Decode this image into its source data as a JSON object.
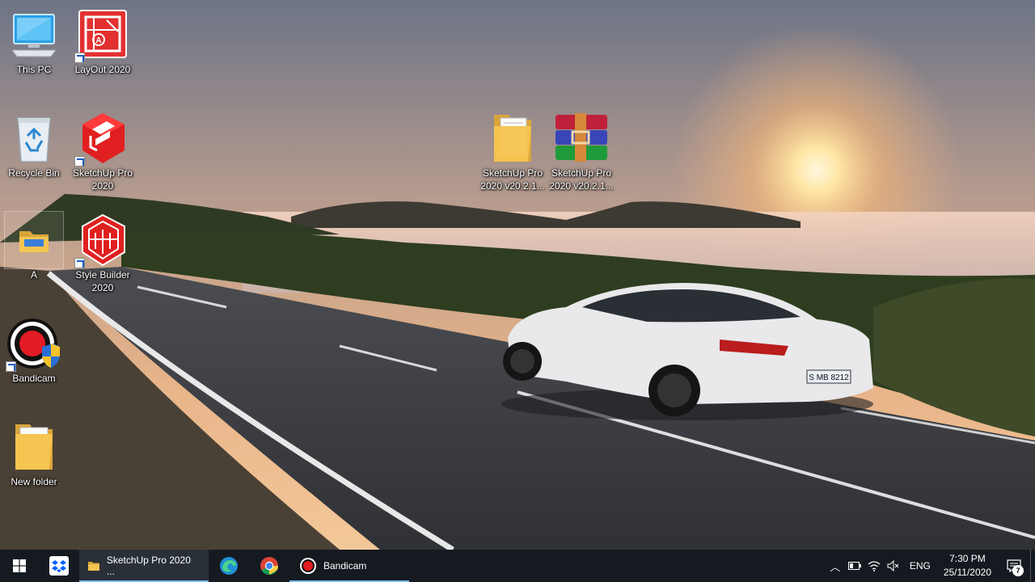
{
  "desktop": {
    "icons": [
      {
        "label": "This PC",
        "icon": "computer-icon"
      },
      {
        "label": "LayOut 2020",
        "icon": "layout-app-icon",
        "shortcut": true
      },
      {
        "label": "Recycle Bin",
        "icon": "recycle-bin-icon"
      },
      {
        "label": "SketchUp Pro 2020",
        "icon": "sketchup-app-icon",
        "shortcut": true
      },
      {
        "label": "A",
        "icon": "folder-icon",
        "selected": true
      },
      {
        "label": "Style Builder 2020",
        "icon": "style-builder-app-icon",
        "shortcut": true
      },
      {
        "label": "Bandicam",
        "icon": "bandicam-app-icon",
        "shortcut": true
      },
      {
        "label": "New folder",
        "icon": "folder-icon"
      },
      {
        "label": "SketchUp Pro 2020 v20.2.1...",
        "icon": "folder-icon"
      },
      {
        "label": "SketchUp Pro 2020 v20.2.1...",
        "icon": "winrar-archive-icon"
      }
    ]
  },
  "taskbar": {
    "start_icon": "windows-start-icon",
    "pinned": [
      {
        "name": "dropbox",
        "icon": "dropbox-icon"
      }
    ],
    "tasks": [
      {
        "label": "SketchUp Pro 2020 ...",
        "icon": "folder-icon",
        "active": true
      },
      {
        "label": "",
        "icon": "edge-icon"
      },
      {
        "label": "",
        "icon": "chrome-icon"
      },
      {
        "label": "Bandicam",
        "icon": "bandicam-record-icon"
      }
    ],
    "tray": {
      "language": "ENG",
      "time": "7:30 PM",
      "date": "25/11/2020",
      "notification_count": "7"
    }
  },
  "colors": {
    "taskbar_bg": "#151a21",
    "active_underline": "#76b9ed",
    "folder_yellow": "#f5c451",
    "sketchup_red": "#e02020"
  }
}
